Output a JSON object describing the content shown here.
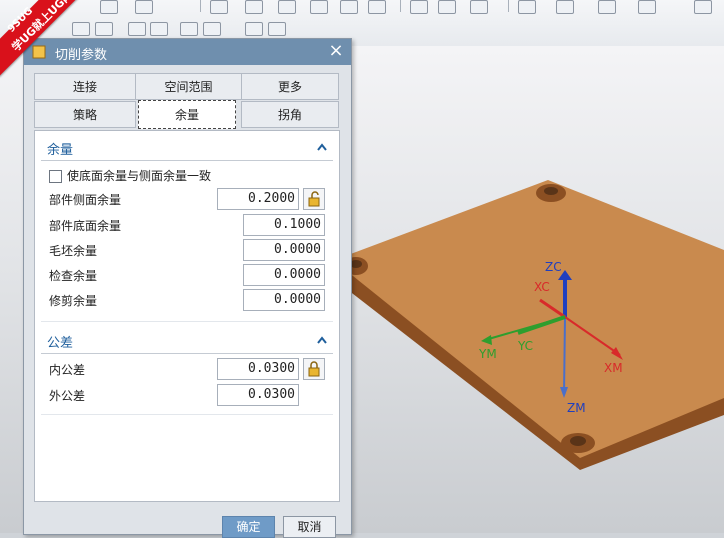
{
  "watermark": {
    "line1": "9SUG",
    "line2": "学UG就上UG网"
  },
  "dialog": {
    "title": "切削参数",
    "close_glyph": "×",
    "tabs_row1": [
      "连接",
      "空间范围",
      "更多"
    ],
    "tabs_row2": [
      "策略",
      "余量",
      "拐角"
    ],
    "active_tab": "余量",
    "stock_section": {
      "title": "余量",
      "checkbox_label": "使底面余量与侧面余量一致",
      "checkbox_checked": false,
      "fields": [
        {
          "label": "部件侧面余量",
          "value": "0.2000"
        },
        {
          "label": "部件底面余量",
          "value": "0.1000"
        },
        {
          "label": "毛坯余量",
          "value": "0.0000"
        },
        {
          "label": "检查余量",
          "value": "0.0000"
        },
        {
          "label": "修剪余量",
          "value": "0.0000"
        }
      ]
    },
    "tolerance_section": {
      "title": "公差",
      "fields": [
        {
          "label": "内公差",
          "value": "0.0300"
        },
        {
          "label": "外公差",
          "value": "0.0300"
        }
      ]
    },
    "ok_label": "确定",
    "cancel_label": "取消"
  },
  "viewport": {
    "axes": {
      "zc": "ZC",
      "xc": "XC",
      "yc": "YC",
      "ym": "YM",
      "yc2": "YC",
      "xm": "XM",
      "zm": "ZM"
    },
    "colors": {
      "plate_top": "#c98a4e",
      "plate_side": "#8b4f22",
      "z_axis": "#1f3fbf",
      "x_axis": "#d82a2a",
      "y_axis": "#2e9e2e"
    }
  }
}
